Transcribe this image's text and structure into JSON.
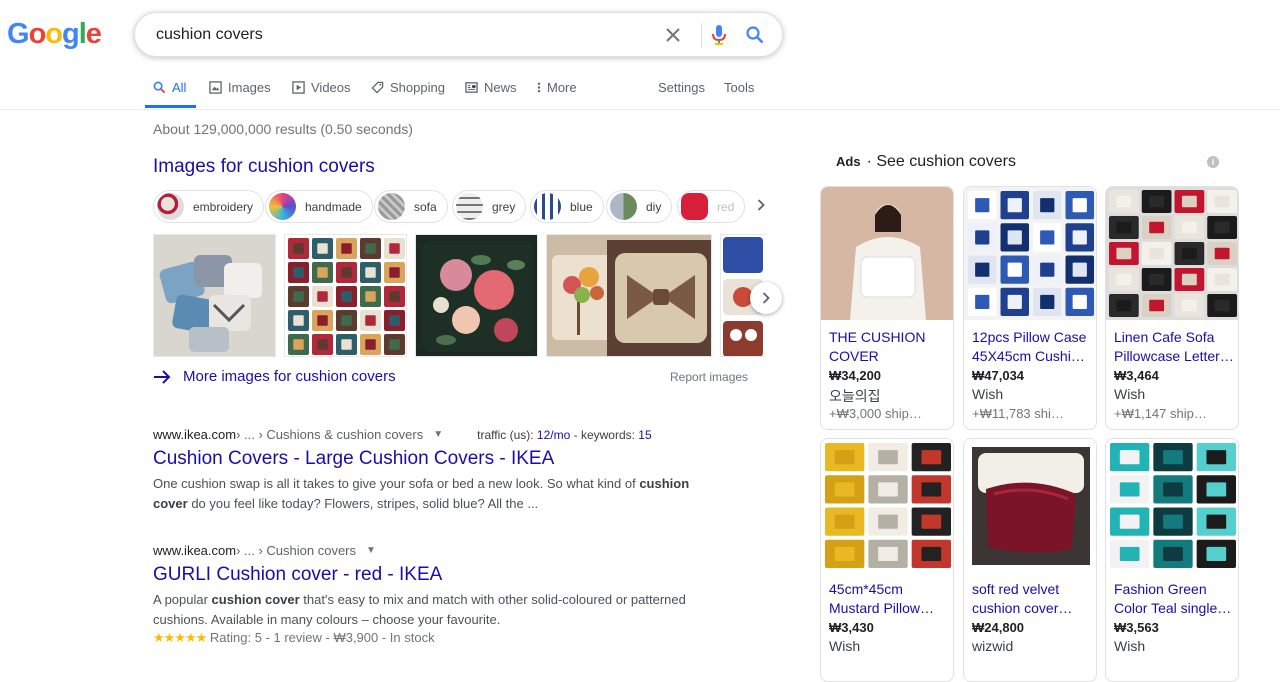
{
  "logo": {
    "text": "Google"
  },
  "search": {
    "query": "cushion covers"
  },
  "tabs": [
    {
      "label": "All",
      "icon": "search-icon"
    },
    {
      "label": "Images",
      "icon": "image-icon"
    },
    {
      "label": "Videos",
      "icon": "video-icon"
    },
    {
      "label": "News",
      "icon": "news-icon"
    },
    {
      "label": "Shopping",
      "icon": "tag-icon"
    },
    {
      "label": "More",
      "icon": "more-vert-icon"
    }
  ],
  "tools": {
    "settings": "Settings",
    "tools": "Tools"
  },
  "stats": "About 129,000,000 results (0.50 seconds)",
  "images": {
    "heading": "Images for cushion covers",
    "chips": [
      "embroidery",
      "handmade",
      "sofa",
      "grey",
      "blue",
      "diy",
      "red"
    ],
    "more": "More images for cushion covers",
    "report": "Report images"
  },
  "results": [
    {
      "domain": "www.ikea.com",
      "crumbs": " › ... › Cushions & cushion covers",
      "seo": {
        "traffic_label": "traffic (us): ",
        "traffic": "12/mo",
        "kw_label": " - keywords: ",
        "keywords": "15"
      },
      "title": "Cushion Covers - Large Cushion Covers - IKEA",
      "snippet_1": "One cushion swap is all it takes to give your sofa or bed a new look. So what kind of ",
      "snippet_b1": "cushion cover",
      "snippet_2": " do you feel like today? Flowers, stripes, solid blue? All the ..."
    },
    {
      "domain": "www.ikea.com",
      "crumbs": " › ... › Cushion covers",
      "title": "GURLI Cushion cover - red - IKEA",
      "snippet_1": "A popular ",
      "snippet_b1": "cushion cover",
      "snippet_2": " that's easy to mix and match with other solid-coloured or patterned cushions. Available in many colours – choose your favourite.",
      "stars": "★★★★★",
      "rating": " Rating: 5 - 1 review - ₩3,900 - In stock"
    }
  ],
  "ads": {
    "label": "Ads",
    "title": "See cushion covers",
    "info": "i",
    "products": [
      {
        "name_1": "THE CUSHION",
        "name_2": "COVER",
        "price": "₩34,200",
        "store": "오늘의집",
        "ship": "+₩3,000 ship…"
      },
      {
        "name_1": "12pcs Pillow Case",
        "name_2": "45X45cm Cushio…",
        "price": "₩47,034",
        "store": "Wish",
        "ship": "+₩11,783 shi…"
      },
      {
        "name_1": "Linen Cafe Sofa",
        "name_2": "Pillowcase Letter…",
        "price": "₩3,464",
        "store": "Wish",
        "ship": "+₩1,147 ship…"
      },
      {
        "name_1": "45cm*45cm",
        "name_2": "Mustard Pillow…",
        "price": "₩3,430",
        "store": "Wish",
        "ship": ""
      },
      {
        "name_1": "soft red velvet",
        "name_2": "cushion cover…",
        "price": "₩24,800",
        "store": "wizwid",
        "ship": ""
      },
      {
        "name_1": "Fashion Green",
        "name_2": "Color Teal single-…",
        "price": "₩3,563",
        "store": "Wish",
        "ship": ""
      }
    ]
  },
  "colors": {
    "link": "#1a0dab",
    "accent": "#1a73e8",
    "muted": "#70757a",
    "star": "#fbbc05"
  }
}
